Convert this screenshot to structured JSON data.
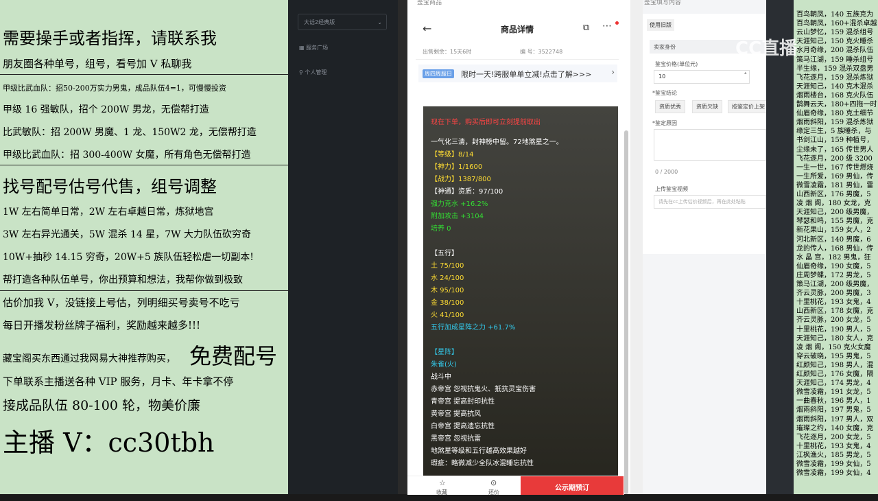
{
  "ad": {
    "lines": [
      {
        "text": "需要操手或者指挥，请联系我"
      },
      {
        "text": "朋友圈各种单号，组号，看号加 V 私聊我"
      },
      {
        "text": "甲级比武血队：招50-200万实力男鬼，成品队伍4=1，可慢慢投资"
      },
      {
        "text": "甲级 16 强敏队，招个 200W 男龙，无偿帮打造"
      },
      {
        "text": "比武敏队：招 200W 男魔、1 龙、150W2 龙，无偿帮打造"
      },
      {
        "text": "甲级比武血队：招 300-400W 女魔，所有角色无偿帮打造"
      },
      {
        "text": "找号配号估号代售，组号调整"
      },
      {
        "text": "1W 左右简单日常，2W 左右卓越日常，炼狱地宫"
      },
      {
        "text": "3W 左右异光通关，5W 混杀 14 星，7W 大力队伍砍穷奇"
      },
      {
        "text": "10W+抽秒 14.15 穷奇，20W+5 族队伍轻松虐一切副本!"
      },
      {
        "text": "帮打造各种队伍单号，你出预算和想法，我帮你做到极致"
      },
      {
        "text": "估价加我 V，没链接上号估，列明细买号卖号不吃亏"
      },
      {
        "text": "每日开播发粉丝牌子福利，奖励越来越多!!!"
      },
      {
        "text": "藏宝阁买东西通过我网易大神推荐购买，"
      },
      {
        "text": "免费配号"
      },
      {
        "text": "下单联系主播送各种 VIP 服务，月卡、年卡拿不停"
      },
      {
        "text": "接成品队伍 80-100 轮，物美价廉"
      },
      {
        "text": "主播 V：cc30tbh"
      }
    ]
  },
  "sidebar": {
    "select_value": "大话2经典版",
    "items": [
      {
        "label": "服务广场"
      },
      {
        "label": "个人管理"
      }
    ]
  },
  "panel": {
    "caption": "鉴宝商品",
    "title": "商品详情",
    "sale_left": "出售剩余：15天6时",
    "code": "编 号：3522748",
    "banner_tag": "周四周服日",
    "banner_text": "限时一天!跨服单单立减!点击了解>>>",
    "card_rows": [
      {
        "text": "现在下单，购买后即可立刻提前取出",
        "color": "#ff4444"
      },
      {
        "text": "一气化三清，封神榜中留。72地煞星之一。",
        "color": "#ffffff"
      },
      {
        "text": "【等级】8/14",
        "color": "#ffdd33"
      },
      {
        "text": "【神力】1/1600",
        "color": "#ffdd33"
      },
      {
        "text": "【战力】1387/800",
        "color": "#ffdd33"
      },
      {
        "text": "【神通】资质：97/100",
        "color": "#ffffff"
      },
      {
        "text": "强力克水 +16.2%",
        "color": "#33dd33"
      },
      {
        "text": "附加攻击 +3104",
        "color": "#33dd33"
      },
      {
        "text": "培养 0",
        "color": "#33dd33"
      },
      {
        "text": "【五行】",
        "color": "#ffffff"
      },
      {
        "text": "土 75/100",
        "color": "#ffdd33"
      },
      {
        "text": "水 24/100",
        "color": "#ffdd33"
      },
      {
        "text": "木 95/100",
        "color": "#ffdd33"
      },
      {
        "text": "金 38/100",
        "color": "#ffdd33"
      },
      {
        "text": "火 41/100",
        "color": "#ffdd33"
      },
      {
        "text": "五行加成星阵之力 +61.7%",
        "color": "#33ccee"
      },
      {
        "text": "【星阵】",
        "color": "#33ccee"
      },
      {
        "text": "朱雀(火)",
        "color": "#33ccee"
      },
      {
        "text": "战斗中",
        "color": "#ffffff"
      },
      {
        "text": "赤帝宫 忽视抗鬼火、抵抗灵宝伤害",
        "color": "#ffffff",
        "accent": "#33dd33"
      },
      {
        "text": "青帝宫 提高封印抗性",
        "color": "#ffffff",
        "accent": "#33dd33"
      },
      {
        "text": "黄帝宫 提高抗风",
        "color": "#ffffff",
        "accent": "#33dd33"
      },
      {
        "text": "白帝宫 提高遗忘抗性",
        "color": "#ffffff",
        "accent": "#33dd33"
      },
      {
        "text": "黑帝宫 忽视抗雷",
        "color": "#ffffff",
        "accent": "#33dd33"
      },
      {
        "text": "地煞星等级和五行越高效果越好",
        "color": "#ffffff"
      },
      {
        "text": "瑕疵：略微减少全队冰混睡忘抗性",
        "color": "#ffffff"
      }
    ],
    "bottom_fav": "收藏",
    "bottom_bargain": "还价",
    "bottom_buy": "公示期预订"
  },
  "form": {
    "caption": "鉴宝填写内容",
    "tab": "使用旧版",
    "seller_label": "卖家身份",
    "price_label": "鉴宝价格(单位元)",
    "price_value": "10",
    "result_label": "*鉴宝结论",
    "chips": [
      "资质优秀",
      "资质欠缺",
      "按鉴定价上架"
    ],
    "reason_label": "*鉴定原因",
    "counter": "0 / 2000",
    "video_label": "上传鉴宝视频",
    "video_hint": "请先在cc上传估价视频后，再在此处粘贴"
  },
  "list": [
    "百鸟朝凤，140 五族克为",
    "百鸟朝凤，160+混杀卓越",
    "云山梦忆，159 混杀组号",
    "天涯知己，150 克火睡杀",
    "水月奇缘，200 混杀队伍",
    "策马江湖，159 睡杀组号",
    "半生缘，159 混杀双盘男",
    "飞花逐月，159 混杀炼狱",
    "天涯知己，140 克木混杀",
    "烟雨楼台，168 克火队伍",
    "鹊舞云天，180+四拖一时",
    "仙眉奇缘，180 克土细节",
    "烟雨斜阳，159 混杀炼狱",
    "缘定三生，5 族睡杀，与",
    "书剑江山，159 种植号，",
    "尘缘未了，165 传世男人",
    "飞花逐月，200 级 3200",
    "一生一世，167 传世燃烧",
    "一生所爱，169 男仙，传",
    "微雪凌霜，181 男仙，雷",
    "山西新区，176 男魔，5",
    "凌 烟 阁，180 女龙，克",
    "天涯知己，200 级男魔，",
    "琴瑟和鸣，155 男魔，克",
    "新花果山，159 女人，2",
    "河北新区，140 男魔，6",
    "龙的传人，168 男仙，传",
    "水 晶 宫，182 男鬼，狂",
    "仙眉奇缘，190 女魔，5",
    "庄周梦蝶，172 男龙，5",
    "策马江湖，200 级男魔，",
    "齐云灵脉，200 男魔，3",
    "十里桃花，193 女鬼，4",
    "山西新区，178 女魔，克",
    "齐云灵脉，200 女龙，5",
    "十里桃花，190 男人，5",
    "天涯知己，180 女人，克",
    "凌 烟 阁，150 克火女魔",
    "穿云破晓，195 男鬼，5",
    "红颜知己，198 男人，混",
    "红颜知己，176 女魔，隔",
    "天涯知己，174 男龙，4",
    "微雪凌霜，191 女龙，5",
    "一曲春秋，196 男人，1",
    "烟雨斜阳，197 男鬼，5",
    "烟雨斜阳，197 男人，双",
    "璀璨之约，140 女魔，克",
    "飞花逐月，200 女龙，5",
    "十里桃花，193 女鬼，4",
    "江枫渔火，185 男龙，5",
    "微雪凌霜，199 女仙，5",
    "微雪凌霜，199 女仙，4"
  ],
  "watermark": "CC直播"
}
